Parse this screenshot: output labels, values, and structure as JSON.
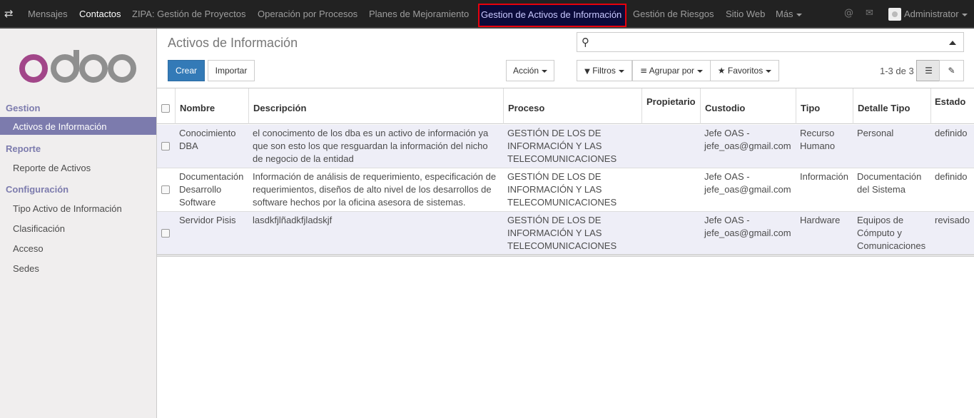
{
  "topbar": {
    "menu": [
      {
        "label": "Mensajes"
      },
      {
        "label": "Contactos"
      },
      {
        "label": "ZIPA: Gestión de Proyectos"
      },
      {
        "label": "Operación por Procesos"
      },
      {
        "label": "Planes de Mejoramiento"
      },
      {
        "label": "Gestion de Activos de Información"
      },
      {
        "label": "Gestión de Riesgos"
      },
      {
        "label": "Sitio Web"
      },
      {
        "label": "Más"
      }
    ],
    "user": "Administrator"
  },
  "sidebar": {
    "logo_text": "odoo",
    "sections": [
      {
        "title": "Gestion",
        "items": [
          {
            "label": "Activos de Información"
          }
        ]
      },
      {
        "title": "Reporte",
        "items": [
          {
            "label": "Reporte de Activos"
          }
        ]
      },
      {
        "title": "Configuración",
        "items": [
          {
            "label": "Tipo Activo de Información"
          },
          {
            "label": "Clasificación"
          },
          {
            "label": "Acceso"
          },
          {
            "label": "Sedes"
          }
        ]
      }
    ]
  },
  "control_panel": {
    "title": "Activos de Información",
    "search_placeholder": "",
    "buttons": {
      "create": "Crear",
      "import": "Importar",
      "action": "Acción",
      "filters": "Filtros",
      "group_by": "Agrupar por",
      "favorites": "Favoritos"
    },
    "pager": "1-3 de 3"
  },
  "table": {
    "columns": [
      "Nombre",
      "Descripción",
      "Proceso",
      "Propietario",
      "Custodio",
      "Tipo",
      "Detalle Tipo",
      "Estado"
    ],
    "rows": [
      {
        "nombre": [
          "Conocimiento",
          "DBA"
        ],
        "descripcion": [
          "el conocimento de los dba es un activo de información ya",
          "que son esto los que resguardan la información del nicho",
          "de negocio de la entidad"
        ],
        "proceso": [
          "GESTIÓN DE LOS DE",
          "INFORMACIÓN Y LAS",
          "TELECOMUNICACIONES"
        ],
        "propietario": "",
        "custodio": [
          "Jefe OAS -",
          "jefe_oas@gmail.com"
        ],
        "tipo": [
          "Recurso",
          "Humano"
        ],
        "detalle": [
          "Personal"
        ],
        "estado": "definido"
      },
      {
        "nombre": [
          "Documentación",
          "Desarrollo",
          "Software"
        ],
        "descripcion": [
          "Información de análisis de requerimiento, especificación de",
          "requerimientos, diseños de alto nivel de los desarrollos de",
          "software hechos por la oficina asesora de sistemas."
        ],
        "proceso": [
          "GESTIÓN DE LOS DE",
          "INFORMACIÓN Y LAS",
          "TELECOMUNICACIONES"
        ],
        "propietario": "",
        "custodio": [
          "Jefe OAS -",
          "jefe_oas@gmail.com"
        ],
        "tipo": [
          "Información"
        ],
        "detalle": [
          "Documentación",
          "del Sistema"
        ],
        "estado": "definido"
      },
      {
        "nombre": [
          "Servidor Pisis"
        ],
        "descripcion": [
          "lasdkfjlñadkfjladskjf"
        ],
        "proceso": [
          "GESTIÓN DE LOS DE",
          "INFORMACIÓN Y LAS",
          "TELECOMUNICACIONES"
        ],
        "propietario": "",
        "custodio": [
          "Jefe OAS -",
          "jefe_oas@gmail.com"
        ],
        "tipo": [
          "Hardware"
        ],
        "detalle": [
          "Equipos de",
          "Cómputo y",
          "Comunicaciones"
        ],
        "estado": "revisado"
      }
    ]
  }
}
